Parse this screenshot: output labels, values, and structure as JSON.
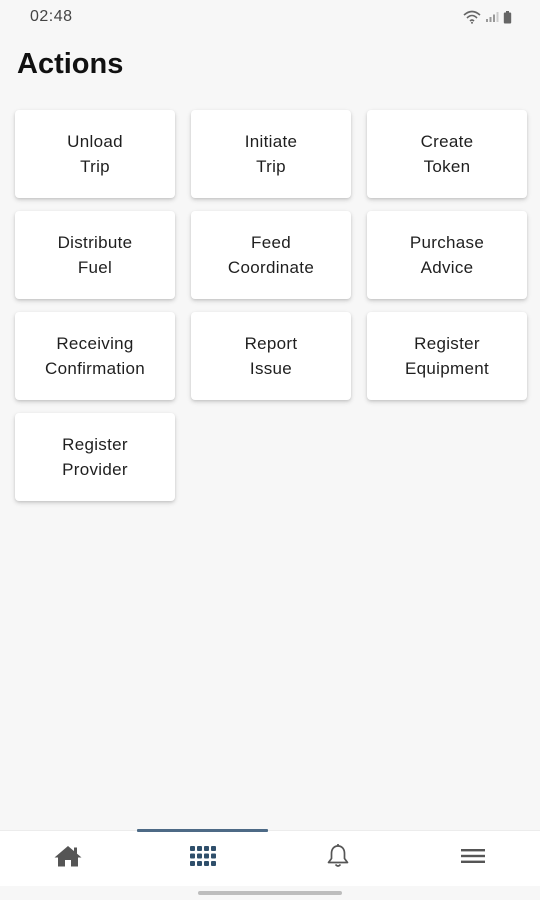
{
  "status_bar": {
    "time": "02:48",
    "icons": [
      "wifi-icon",
      "signal-icon",
      "battery-icon"
    ]
  },
  "page": {
    "title": "Actions"
  },
  "actions": [
    {
      "line1": "Unload",
      "line2": "Trip"
    },
    {
      "line1": "Initiate",
      "line2": "Trip"
    },
    {
      "line1": "Create",
      "line2": "Token"
    },
    {
      "line1": "Distribute",
      "line2": "Fuel"
    },
    {
      "line1": "Feed",
      "line2": "Coordinate"
    },
    {
      "line1": "Purchase",
      "line2": "Advice"
    },
    {
      "line1": "Receiving",
      "line2": "Confirmation"
    },
    {
      "line1": "Report",
      "line2": "Issue"
    },
    {
      "line1": "Register",
      "line2": "Equipment"
    },
    {
      "line1": "Register",
      "line2": "Provider"
    }
  ],
  "bottom_nav": {
    "items": [
      {
        "icon": "home-icon",
        "active": false
      },
      {
        "icon": "grid-icon",
        "active": true
      },
      {
        "icon": "bell-icon",
        "active": false
      },
      {
        "icon": "menu-icon",
        "active": false
      }
    ]
  },
  "colors": {
    "background": "#f7f7f7",
    "card": "#ffffff",
    "nav_active": "#2f4f6b",
    "nav_inactive": "#555555"
  }
}
